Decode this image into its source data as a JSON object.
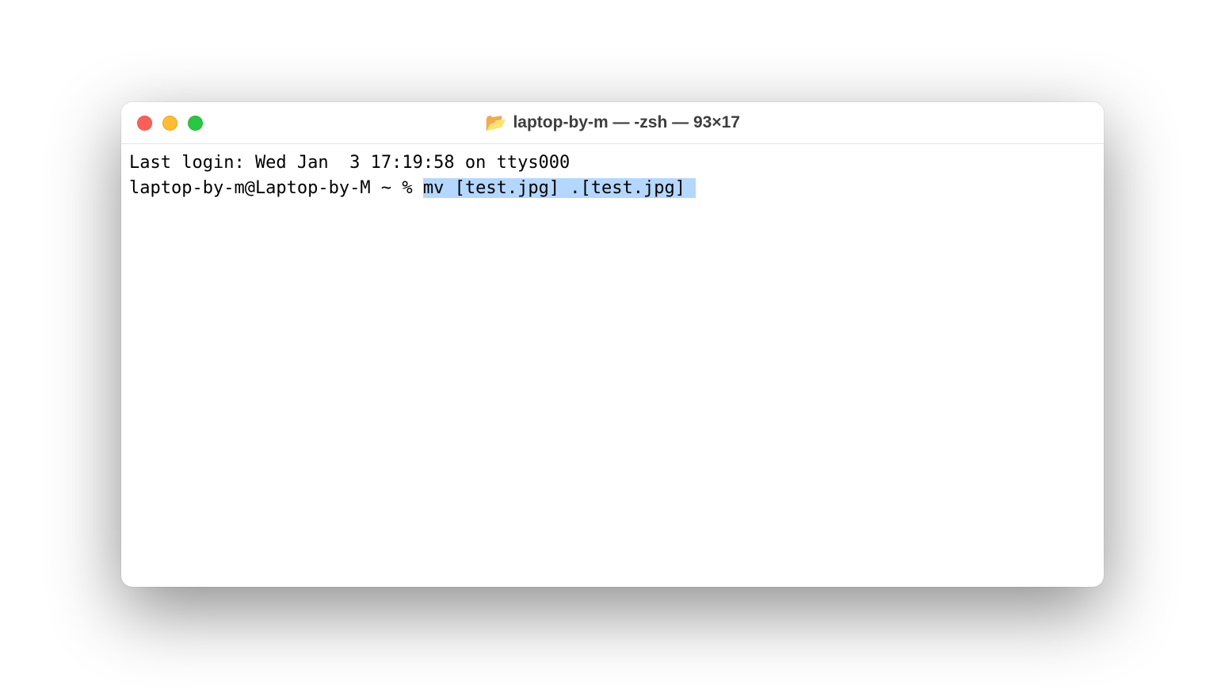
{
  "window": {
    "title": "laptop-by-m — -zsh — 93×17"
  },
  "terminal": {
    "last_login": "Last login: Wed Jan  3 17:19:58 on ttys000",
    "prompt": "laptop-by-m@Laptop-by-M ~ % ",
    "command_selected": "mv [test.jpg] .[test.jpg] "
  }
}
